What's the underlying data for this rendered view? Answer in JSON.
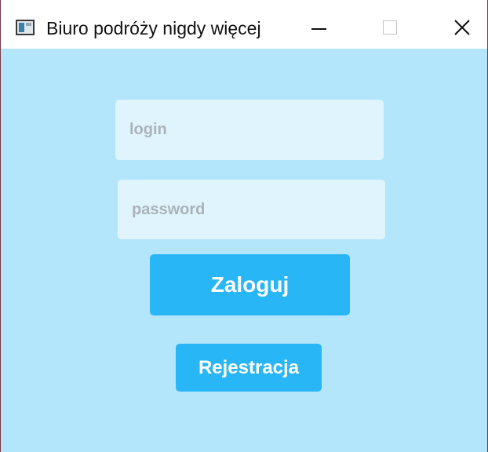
{
  "window": {
    "title": "Biuro podróży nigdy więcej",
    "icon": "app-window-icon",
    "controls": [
      "minimize-icon",
      "maximize-icon",
      "close-icon"
    ],
    "content_background": "#b3e5fb"
  },
  "login_form": {
    "login_placeholder": "login",
    "login_value": "",
    "password_placeholder": "password",
    "password_value": "",
    "login_button_label": "Zaloguj",
    "register_button_label": "Rejestracja",
    "button_color": "#29b6f6",
    "field_color": "#e0f4fd"
  }
}
